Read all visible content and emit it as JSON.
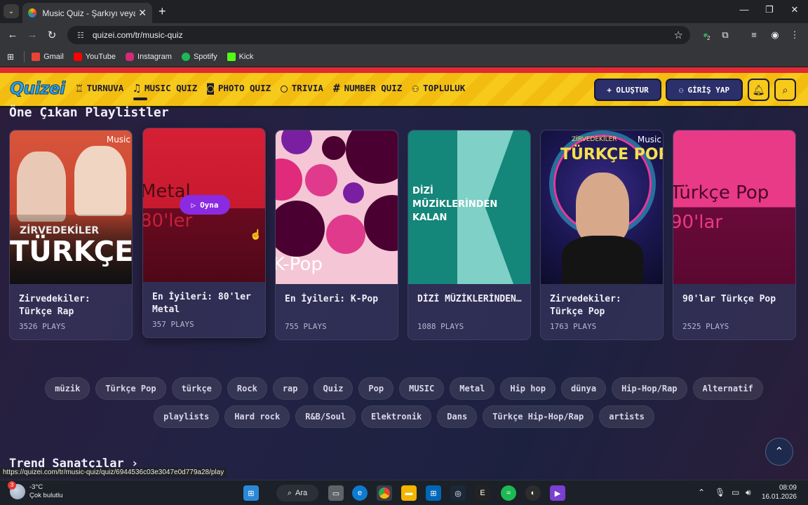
{
  "browser": {
    "tab_title": "Music Quiz - Şarkıyı veya sanat",
    "url": "quizei.com/tr/music-quiz",
    "status_url": "https://quizei.com/tr/music-quiz/quiz/6944536c03e3047e0d779a28/play",
    "extension_badge": "2",
    "bookmarks": [
      {
        "label": "Gmail",
        "color": "#ea4335"
      },
      {
        "label": "YouTube",
        "color": "#ff0000"
      },
      {
        "label": "Instagram",
        "color": "#d62976"
      },
      {
        "label": "Spotify",
        "color": "#1db954"
      },
      {
        "label": "Kick",
        "color": "#53fc18"
      }
    ]
  },
  "site": {
    "logo": "Quizei",
    "nav": [
      {
        "label": "TURNUVA",
        "icon": "trophy-icon",
        "glyph": "♖"
      },
      {
        "label": "MUSIC QUIZ",
        "icon": "music-note-icon",
        "glyph": "♫"
      },
      {
        "label": "PHOTO QUIZ",
        "icon": "camera-icon",
        "glyph": "◙"
      },
      {
        "label": "TRIVIA",
        "icon": "chat-bubble-icon",
        "glyph": "◯"
      },
      {
        "label": "NUMBER QUIZ",
        "icon": "hash-icon",
        "glyph": "#"
      },
      {
        "label": "TOPLULUK",
        "icon": "people-icon",
        "glyph": "⚇"
      }
    ],
    "create_label": "+ OLUŞTUR",
    "login_label": "GİRİŞ YAP"
  },
  "section_title": "Öne Çıkan Playlistler",
  "cards": [
    {
      "title": "Zirvedekiler: Türkçe Rap",
      "plays": "3526 PLAYS",
      "art_text": "TÜRKÇE RAP",
      "art_sub": "ZİRVEDEKİLER"
    },
    {
      "title": "En İyileri: 80'ler Metal",
      "plays": "357 PLAYS",
      "art_text": "Metal",
      "art_sub": "80'ler",
      "play_label": "Oyna"
    },
    {
      "title": "En İyileri: K-Pop",
      "plays": "755 PLAYS",
      "art_text": "K-Pop"
    },
    {
      "title": "DİZİ MÜZİKLERİNDEN…",
      "plays": "1088 PLAYS",
      "art_text": "DİZİ MÜZİKLERİNDEN KALAN"
    },
    {
      "title": "Zirvedekiler: Türkçe Pop",
      "plays": "1763 PLAYS",
      "art_text": "TÜRKÇE POP",
      "art_sub": "ZİRVEDEKİLER"
    },
    {
      "title": "90'lar Türkçe Pop",
      "plays": "2525 PLAYS",
      "art_text": "Türkçe Pop",
      "art_sub": "90'lar"
    }
  ],
  "apple_music": " Music",
  "tags_row1": [
    "müzik",
    "Türkçe Pop",
    "türkçe",
    "Rock",
    "rap",
    "Quiz",
    "Pop",
    "MUSIC",
    "Metal",
    "Hip hop",
    "dünya",
    "Hip-Hop/Rap",
    "Alternatif"
  ],
  "tags_row2": [
    "playlists",
    "Hard rock",
    "R&B/Soul",
    "Elektronik",
    "Dans",
    "Türkçe Hip-Hop/Rap",
    "artists"
  ],
  "trend_title": "Trend Sanatçılar",
  "taskbar": {
    "temp": "-3°C",
    "weather": "Çok bulutlu",
    "weather_badge": "3",
    "search": "Ara",
    "time": "08:09",
    "date": "16.01.2026"
  }
}
